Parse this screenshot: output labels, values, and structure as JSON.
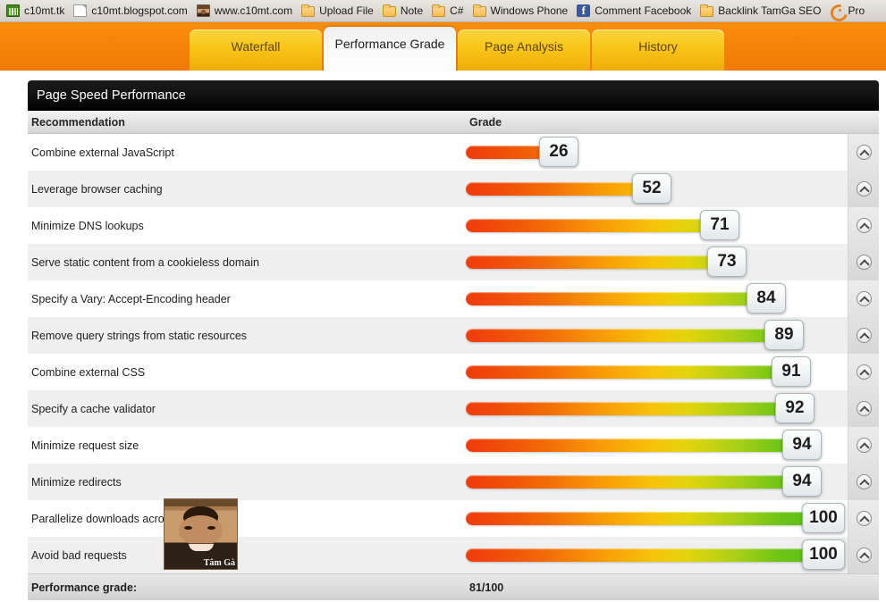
{
  "bookmarks": [
    {
      "icon": "chart-favicon-icon",
      "label": "c10mt.tk"
    },
    {
      "icon": "page-icon",
      "label": "c10mt.blogspot.com"
    },
    {
      "icon": "photo-favicon-icon",
      "label": "www.c10mt.com"
    },
    {
      "icon": "folder-icon",
      "label": "Upload File"
    },
    {
      "icon": "folder-icon",
      "label": "Note"
    },
    {
      "icon": "folder-icon",
      "label": "C#"
    },
    {
      "icon": "folder-icon",
      "label": "Windows Phone"
    },
    {
      "icon": "facebook-icon",
      "label": "Comment Facebook"
    },
    {
      "icon": "folder-icon",
      "label": "Backlink TamGa SEO"
    },
    {
      "icon": "crescent-icon",
      "label": "Pro"
    }
  ],
  "tabs": [
    {
      "label": "Waterfall",
      "active": false
    },
    {
      "label": "Performance Grade",
      "active": true
    },
    {
      "label": "Page Analysis",
      "active": false
    },
    {
      "label": "History",
      "active": false
    }
  ],
  "panel": {
    "title": "Page Speed Performance",
    "columns": {
      "recommendation": "Recommendation",
      "grade": "Grade"
    },
    "footer_label": "Performance grade:",
    "footer_value": "81/100"
  },
  "watermark": "Tâm Gà www.c10mt.com",
  "avatar": {
    "caption": "Tâm Gà"
  },
  "chart_data": {
    "type": "bar",
    "title": "Page Speed Performance",
    "xlabel": "Grade",
    "ylabel": "Recommendation",
    "xlim": [
      0,
      100
    ],
    "grid": false,
    "legend": "none",
    "overall_grade": "81/100",
    "categories": [
      "Combine external JavaScript",
      "Leverage browser caching",
      "Minimize DNS lookups",
      "Serve static content from a cookieless domain",
      "Specify a Vary: Accept-Encoding header",
      "Remove query strings from static resources",
      "Combine external CSS",
      "Specify a cache validator",
      "Minimize request size",
      "Minimize redirects",
      "Parallelize downloads across hostnames",
      "Avoid bad requests"
    ],
    "values": [
      26,
      52,
      71,
      73,
      84,
      89,
      91,
      92,
      94,
      94,
      100,
      100
    ]
  },
  "rows": [
    {
      "label": "Combine external JavaScript",
      "value": "26",
      "pct": 26,
      "action": "collapse-icon"
    },
    {
      "label": "Leverage browser caching",
      "value": "52",
      "pct": 52,
      "action": "collapse-icon"
    },
    {
      "label": "Minimize DNS lookups",
      "value": "71",
      "pct": 71,
      "action": "collapse-icon"
    },
    {
      "label": "Serve static content from a cookieless domain",
      "value": "73",
      "pct": 73,
      "action": "collapse-icon"
    },
    {
      "label": "Specify a Vary: Accept-Encoding header",
      "value": "84",
      "pct": 84,
      "action": "collapse-icon"
    },
    {
      "label": "Remove query strings from static resources",
      "value": "89",
      "pct": 89,
      "action": "collapse-icon"
    },
    {
      "label": "Combine external CSS",
      "value": "91",
      "pct": 91,
      "action": "collapse-icon"
    },
    {
      "label": "Specify a cache validator",
      "value": "92",
      "pct": 92,
      "action": "collapse-icon"
    },
    {
      "label": "Minimize request size",
      "value": "94",
      "pct": 94,
      "action": "collapse-icon"
    },
    {
      "label": "Minimize redirects",
      "value": "94",
      "pct": 94,
      "action": "collapse-icon"
    },
    {
      "label": "Parallelize downloads across hostnames",
      "value": "100",
      "pct": 100,
      "action": "collapse-icon"
    },
    {
      "label": "Avoid bad requests",
      "value": "100",
      "pct": 100,
      "action": "collapse-icon"
    }
  ]
}
